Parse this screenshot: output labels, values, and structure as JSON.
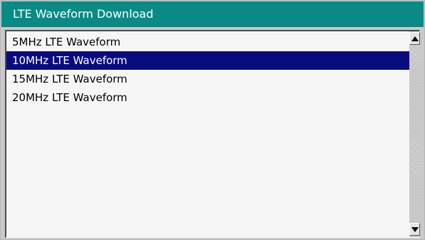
{
  "window": {
    "title": "LTE Waveform Download"
  },
  "list": {
    "items": [
      {
        "label": "5MHz LTE Waveform",
        "selected": false
      },
      {
        "label": "10MHz LTE Waveform",
        "selected": true
      },
      {
        "label": "15MHz LTE Waveform",
        "selected": false
      },
      {
        "label": "20MHz LTE Waveform",
        "selected": false
      }
    ]
  },
  "icons": {
    "scroll_up": "arrow-up-icon",
    "scroll_down": "arrow-down-icon"
  },
  "colors": {
    "titlebar": "#0a8a85",
    "selection": "#0b0b80",
    "list_background": "#f6f6f6"
  }
}
